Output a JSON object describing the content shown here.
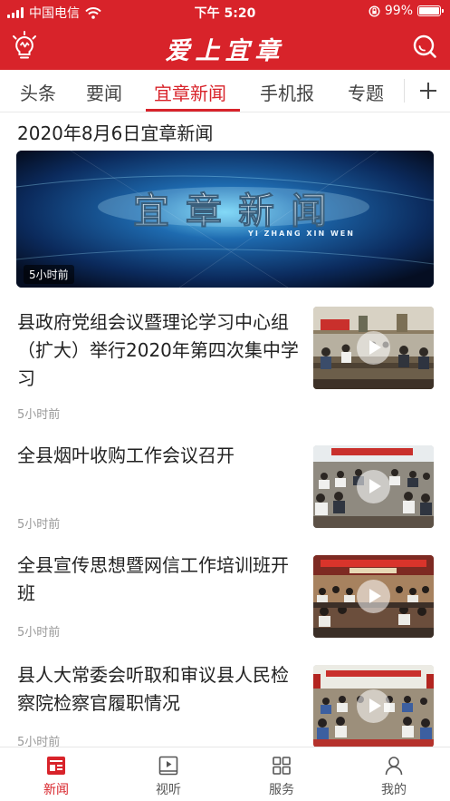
{
  "status_bar": {
    "carrier": "中国电信",
    "time": "下午 5:20",
    "battery": "99%",
    "battery_level": 0.99,
    "signal_bars": 4,
    "icons": [
      "signal-icon",
      "wifi-icon",
      "rotation-lock-icon",
      "battery-icon"
    ]
  },
  "header": {
    "title": "爱上宜章",
    "left_icon": "lightbulb-icon",
    "right_icon": "search-icon",
    "background_color": "#d8232a"
  },
  "tabs": {
    "items": [
      {
        "label": "头条",
        "active": false
      },
      {
        "label": "要闻",
        "active": false
      },
      {
        "label": "宜章新闻",
        "active": true
      },
      {
        "label": "手机报",
        "active": false
      },
      {
        "label": "专题",
        "active": false
      }
    ],
    "add_icon": "plus-icon",
    "active_color": "#d8232a"
  },
  "main": {
    "section_title": "2020年8月6日宜章新闻",
    "banner": {
      "overlay_text": "宜章新闻",
      "overlay_subtext": "YI ZHANG XIN WEN",
      "time": "5小时前"
    },
    "news": [
      {
        "title": "县政府党组会议暨理论学习中心组（扩大）举行2020年第四次集中学习",
        "time": "5小时前",
        "has_video": true
      },
      {
        "title": "全县烟叶收购工作会议召开",
        "time": "5小时前",
        "has_video": true
      },
      {
        "title": "全县宣传思想暨网信工作培训班开班",
        "time": "5小时前",
        "has_video": true
      },
      {
        "title": "县人大常委会听取和审议县人民检察院检察官履职情况",
        "time": "5小时前",
        "has_video": true
      }
    ]
  },
  "bottom_nav": {
    "items": [
      {
        "label": "新闻",
        "icon": "newspaper-icon",
        "active": true
      },
      {
        "label": "视听",
        "icon": "video-play-icon",
        "active": false
      },
      {
        "label": "服务",
        "icon": "grid-icon",
        "active": false
      },
      {
        "label": "我的",
        "icon": "user-icon",
        "active": false
      }
    ]
  }
}
